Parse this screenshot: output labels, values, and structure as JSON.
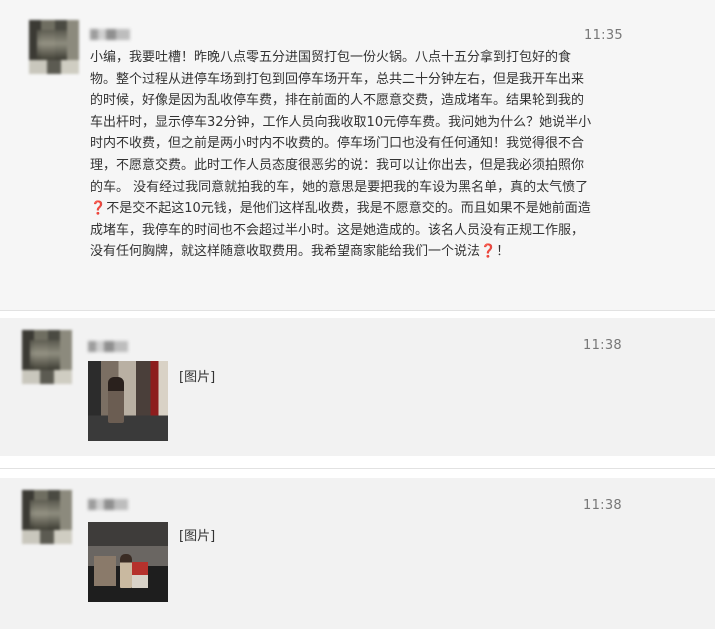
{
  "messages": [
    {
      "time": "11:35",
      "text_part1": "小编，我要吐槽！昨晚八点零五分进国贸打包一份火锅。八点十五分拿到打包好的食物。整个过程从进停车场到打包到回停车场开车，总共二十分钟左右，但是我开车出来的时候，好像是因为乱收停车费，排在前面的人不愿意交费，造成堵车。结果轮到我的车出杆时，显示停车32分钟，工作人员向我收取10元停车费。我问她为什么？她说半小时内不收费，但之前是两小时内不收费的。停车场门口也没有任何通知！我觉得很不合理，不愿意交费。此时工作人员态度很恶劣的说：我可以让你出去，但是我必须拍照你的车。 没有经过我同意就拍我的车，她的意思是要把我的车设为黑名单，真的太气愤了",
      "emoji1": "❓",
      "text_part2": "不是交不起这10元钱，是他们这样乱收费，我是不愿意交的。而且如果不是她前面造成堵车，我停车的时间也不会超过半小时。这是她造成的。该名人员没有正规工作服，没有任何胸牌，就这样随意收取费用。我希望商家能给我们一个说法",
      "emoji2": "❓",
      "text_end": "！"
    },
    {
      "time": "11:38",
      "image_label": "[图片]"
    },
    {
      "time": "11:38",
      "image_label": "[图片]"
    }
  ]
}
